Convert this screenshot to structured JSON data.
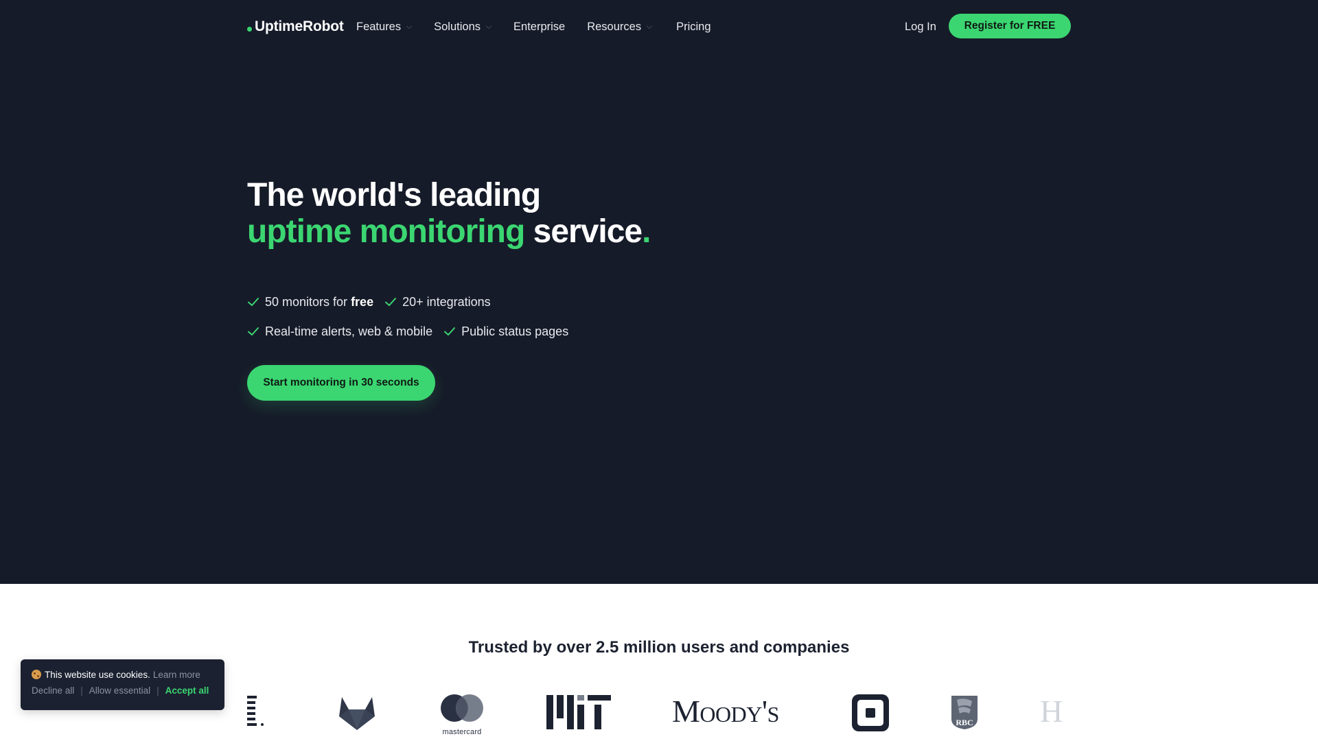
{
  "nav": {
    "logo": "UptimeRobot",
    "items": [
      {
        "label": "Features",
        "has_dropdown": true
      },
      {
        "label": "Solutions",
        "has_dropdown": true
      },
      {
        "label": "Enterprise",
        "has_dropdown": false
      },
      {
        "label": "Resources",
        "has_dropdown": true
      },
      {
        "label": "Pricing",
        "has_dropdown": false
      }
    ],
    "login": "Log In",
    "register": "Register for FREE"
  },
  "hero": {
    "line1": "The world's leading",
    "line2_green": "uptime monitoring",
    "line2_white": " service",
    "line2_dot": ".",
    "features": {
      "f1": "50 monitors for",
      "f1_bold": "free",
      "f2": "20+ integrations",
      "f3": "Real-time alerts, web & mobile",
      "f4": "Public status pages"
    },
    "cta": "Start monitoring in 30 seconds"
  },
  "trusted": {
    "heading": "Trusted by over 2.5 million users and companies",
    "logos": [
      "partial-logo",
      "gitlab",
      "mastercard",
      "mit",
      "moodys",
      "square",
      "rbc",
      "partial-logo-right"
    ],
    "mastercard_text": "mastercard",
    "moodys_text": "Moody's",
    "rbc_text": "RBC",
    "partial_right_text": "H"
  },
  "cookie": {
    "message": "This website use cookies.",
    "learn_more": "Learn more",
    "decline": "Decline all",
    "allow_essential": "Allow essential",
    "accept": "Accept all",
    "separator": "|"
  },
  "colors": {
    "hero_bg": "#161b29",
    "accent": "#3bd671",
    "text_dark": "#1c2230"
  }
}
